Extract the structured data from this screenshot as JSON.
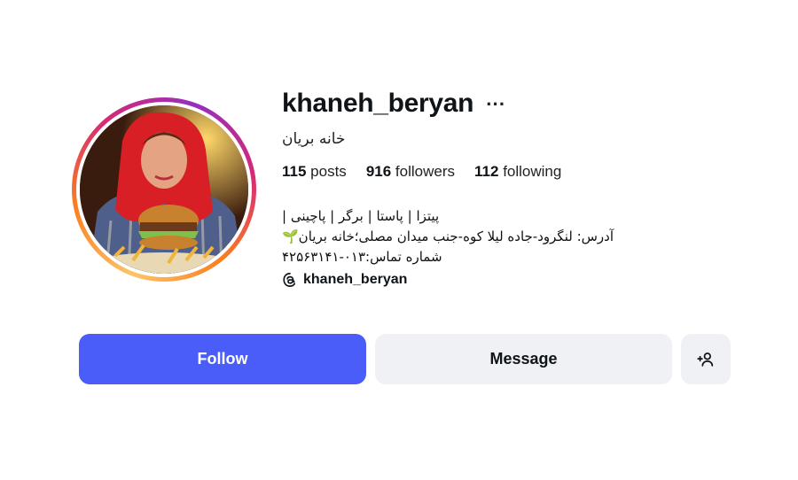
{
  "profile": {
    "username": "khaneh_beryan",
    "more_icon": "···",
    "full_name": "خانه بریان",
    "stats": {
      "posts_count": "115",
      "posts_label": "posts",
      "followers_count": "916",
      "followers_label": "followers",
      "following_count": "112",
      "following_label": "following"
    },
    "bio_lines": [
      "پیتزا | پاستا | برگر | پاچینی |",
      "آدرس: لنگرود-جاده لیلا کوه-جنب میدان مصلی؛خانه بریان🌱",
      "شماره تماس:۰۱۳-۴۲۵۶۳۱۴۱"
    ],
    "threads_handle": "khaneh_beryan"
  },
  "actions": {
    "follow_label": "Follow",
    "message_label": "Message"
  },
  "colors": {
    "follow_bg": "#4a5df9",
    "secondary_bg": "#eff1f5",
    "ring_gradient": [
      "#fdc468",
      "#fa7e1e",
      "#d62976",
      "#962fbf"
    ]
  },
  "icons": {
    "more": "more-icon",
    "threads": "threads-icon",
    "add_user": "add-user-icon"
  }
}
